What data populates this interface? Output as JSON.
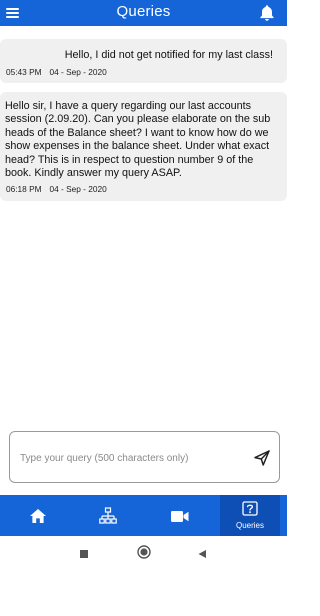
{
  "app_bar": {
    "title": "Queries",
    "menu_icon": "hamburger-menu-icon",
    "notification_icon": "bell-icon",
    "color": "#1565d8"
  },
  "messages": [
    {
      "text": "Hello, I did not get notified for my last class!",
      "time": "05:43 PM",
      "date": "04 - Sep - 2020"
    },
    {
      "text": "Hello sir, I have a query regarding our last accounts session (2.09.20). Can you please elaborate on the sub heads of the Balance sheet? I want to know how do we show expenses in the balance sheet. Under what exact head? This is in respect to question number 9 of the book. Kindly answer my query ASAP.",
      "time": "06:18 PM",
      "date": "04 - Sep - 2020"
    }
  ],
  "composer": {
    "placeholder": "Type your query (500 characters only)",
    "value": "",
    "send_icon": "send-icon"
  },
  "bottom_nav": {
    "items": [
      {
        "icon": "home-icon",
        "label": ""
      },
      {
        "icon": "network-icon",
        "label": ""
      },
      {
        "icon": "video-camera-icon",
        "label": ""
      },
      {
        "icon": "question-icon",
        "label": "Queries",
        "active": true
      }
    ]
  },
  "system_nav": {
    "icons": [
      "square-recents-icon",
      "circle-home-icon",
      "triangle-back-icon"
    ]
  }
}
